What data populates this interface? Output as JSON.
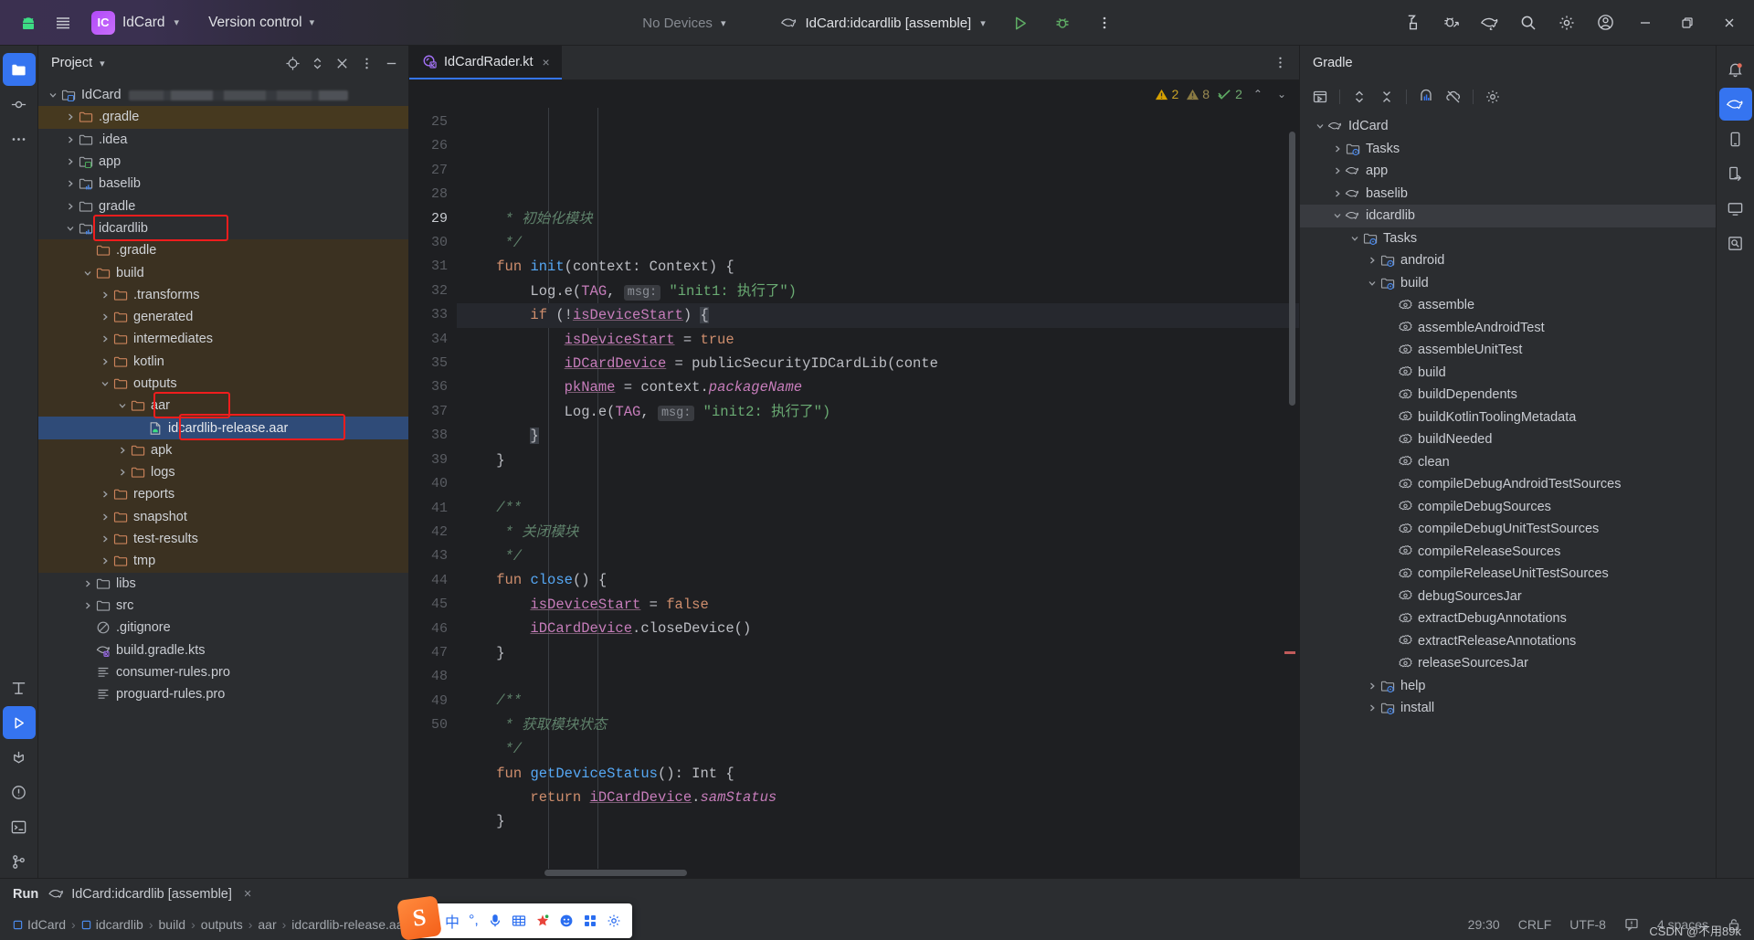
{
  "titlebar": {
    "android_icon": "android-icon",
    "menu_icon": "hamburger-menu-icon",
    "ide_badge": "IC",
    "project_name": "IdCard",
    "version_control": "Version control",
    "devices": "No Devices",
    "run_config": "IdCard:idcardlib [assemble]",
    "run_icon": "run-icon",
    "debug_icon": "debug-icon",
    "more_icon": "more-vertical-icon",
    "right_icons": [
      "build-icon",
      "debug-attach-icon",
      "gradle-elephant-icon",
      "search-icon",
      "settings-gear-icon",
      "account-avatar-icon"
    ],
    "window_min": "minimize-icon",
    "window_max": "restore-icon",
    "window_close": "close-icon"
  },
  "left_rail": {
    "items": [
      {
        "name": "project-tool-icon",
        "active": true
      },
      {
        "name": "commit-tool-icon",
        "active": false
      },
      {
        "name": "more-tools-icon",
        "active": false
      }
    ],
    "bottom_items": [
      {
        "name": "structure-tool-icon"
      },
      {
        "name": "run-tool-icon",
        "active": true
      },
      {
        "name": "build-tool-icon"
      },
      {
        "name": "problems-tool-icon"
      },
      {
        "name": "terminal-tool-icon"
      },
      {
        "name": "git-tool-icon"
      }
    ]
  },
  "project_panel": {
    "title": "Project",
    "actions": [
      "select-opened-file-icon",
      "expand-collapse-icon",
      "hide-icon",
      "options-icon",
      "minimize-icon"
    ],
    "tree": [
      {
        "label": "IdCard",
        "indent": 0,
        "arrow": "down",
        "icon": "module-folder-icon",
        "meta": "blurred-path",
        "state": "normal"
      },
      {
        "label": ".gradle",
        "indent": 1,
        "arrow": "right",
        "icon": "excluded-folder-icon",
        "state": "highlight"
      },
      {
        "label": ".idea",
        "indent": 1,
        "arrow": "right",
        "icon": "folder-icon",
        "state": "normal"
      },
      {
        "label": "app",
        "indent": 1,
        "arrow": "right",
        "icon": "module-folder-green-icon",
        "state": "normal"
      },
      {
        "label": "baselib",
        "indent": 1,
        "arrow": "right",
        "icon": "module-folder-lib-icon",
        "state": "normal"
      },
      {
        "label": "gradle",
        "indent": 1,
        "arrow": "right",
        "icon": "folder-icon",
        "state": "normal"
      },
      {
        "label": "idcardlib",
        "indent": 1,
        "arrow": "down",
        "icon": "module-folder-lib-icon",
        "state": "normal",
        "redbox": true
      },
      {
        "label": ".gradle",
        "indent": 2,
        "arrow": "none",
        "icon": "excluded-folder-icon",
        "state": "excluded"
      },
      {
        "label": "build",
        "indent": 2,
        "arrow": "down",
        "icon": "excluded-folder-icon",
        "state": "excluded"
      },
      {
        "label": ".transforms",
        "indent": 3,
        "arrow": "right",
        "icon": "excluded-folder-icon",
        "state": "excluded"
      },
      {
        "label": "generated",
        "indent": 3,
        "arrow": "right",
        "icon": "excluded-folder-icon",
        "state": "excluded"
      },
      {
        "label": "intermediates",
        "indent": 3,
        "arrow": "right",
        "icon": "excluded-folder-icon",
        "state": "excluded"
      },
      {
        "label": "kotlin",
        "indent": 3,
        "arrow": "right",
        "icon": "excluded-folder-icon",
        "state": "excluded"
      },
      {
        "label": "outputs",
        "indent": 3,
        "arrow": "down",
        "icon": "excluded-folder-icon",
        "state": "excluded"
      },
      {
        "label": "aar",
        "indent": 4,
        "arrow": "down",
        "icon": "excluded-folder-icon",
        "state": "excluded",
        "redbox": true
      },
      {
        "label": "idcardlib-release.aar",
        "indent": 5,
        "arrow": "none",
        "icon": "aar-file-icon",
        "state": "selected",
        "redbox": true
      },
      {
        "label": "apk",
        "indent": 4,
        "arrow": "right",
        "icon": "excluded-folder-icon",
        "state": "excluded"
      },
      {
        "label": "logs",
        "indent": 4,
        "arrow": "right",
        "icon": "excluded-folder-icon",
        "state": "excluded"
      },
      {
        "label": "reports",
        "indent": 3,
        "arrow": "right",
        "icon": "excluded-folder-icon",
        "state": "excluded"
      },
      {
        "label": "snapshot",
        "indent": 3,
        "arrow": "right",
        "icon": "excluded-folder-icon",
        "state": "excluded"
      },
      {
        "label": "test-results",
        "indent": 3,
        "arrow": "right",
        "icon": "excluded-folder-icon",
        "state": "excluded"
      },
      {
        "label": "tmp",
        "indent": 3,
        "arrow": "right",
        "icon": "excluded-folder-icon",
        "state": "excluded"
      },
      {
        "label": "libs",
        "indent": 2,
        "arrow": "right",
        "icon": "folder-icon",
        "state": "normal"
      },
      {
        "label": "src",
        "indent": 2,
        "arrow": "right",
        "icon": "folder-icon",
        "state": "normal"
      },
      {
        "label": ".gitignore",
        "indent": 2,
        "arrow": "none",
        "icon": "gitignore-icon",
        "state": "normal"
      },
      {
        "label": "build.gradle.kts",
        "indent": 2,
        "arrow": "none",
        "icon": "gradle-kts-icon",
        "state": "normal"
      },
      {
        "label": "consumer-rules.pro",
        "indent": 2,
        "arrow": "none",
        "icon": "text-file-icon",
        "state": "normal"
      },
      {
        "label": "proguard-rules.pro",
        "indent": 2,
        "arrow": "none",
        "icon": "text-file-icon",
        "state": "normal"
      }
    ]
  },
  "editor": {
    "tab": {
      "label": "IdCardRader.kt",
      "icon": "kotlin-class-icon",
      "close": "×"
    },
    "tab_options_icon": "more-vertical-icon",
    "inspections": {
      "error_icon": "warning-triangle-icon",
      "error_count": "2",
      "warn_icon": "weak-warning-triangle-icon",
      "warn_count": "8",
      "ok_icon": "checkmark-icon",
      "ok_count": "2",
      "prev": "⌃",
      "next": "⌄"
    },
    "first_line_number": 25,
    "current_line": 29,
    "lines": [
      {
        "n": 25,
        "segments": [
          {
            "t": "     * ",
            "c": "cmt"
          },
          {
            "t": "初始化模块",
            "c": "cmt"
          }
        ]
      },
      {
        "n": 26,
        "segments": [
          {
            "t": "     */",
            "c": "cmt"
          }
        ]
      },
      {
        "n": 27,
        "segments": [
          {
            "t": "    ",
            "c": "plain"
          },
          {
            "t": "fun ",
            "c": "kw"
          },
          {
            "t": "init",
            "c": "fn"
          },
          {
            "t": "(context: Context) {",
            "c": "plain"
          }
        ]
      },
      {
        "n": 28,
        "segments": [
          {
            "t": "        Log.e(",
            "c": "plain"
          },
          {
            "t": "TAG",
            "c": "fld"
          },
          {
            "t": ", ",
            "c": "plain"
          },
          {
            "t": "msg:",
            "c": "hint"
          },
          {
            "t": " \"init1: 执行了\")",
            "c": "str"
          }
        ]
      },
      {
        "n": 29,
        "segments": [
          {
            "t": "        ",
            "c": "plain"
          },
          {
            "t": "if ",
            "c": "kw"
          },
          {
            "t": "(!",
            "c": "plain"
          },
          {
            "t": "isDeviceStart",
            "c": "fldu"
          },
          {
            "t": ") ",
            "c": "plain"
          },
          {
            "t": "{",
            "c": "caret"
          }
        ]
      },
      {
        "n": 30,
        "segments": [
          {
            "t": "            ",
            "c": "plain"
          },
          {
            "t": "isDeviceStart",
            "c": "fldu"
          },
          {
            "t": " = ",
            "c": "plain"
          },
          {
            "t": "true",
            "c": "kw"
          }
        ]
      },
      {
        "n": 31,
        "segments": [
          {
            "t": "            ",
            "c": "plain"
          },
          {
            "t": "iDCardDevice",
            "c": "fldu"
          },
          {
            "t": " = publicSecurityIDCardLib(conte",
            "c": "plain"
          }
        ]
      },
      {
        "n": 32,
        "segments": [
          {
            "t": "            ",
            "c": "plain"
          },
          {
            "t": "pkName",
            "c": "fldu"
          },
          {
            "t": " = context.",
            "c": "plain"
          },
          {
            "t": "packageName",
            "c": "italic"
          }
        ]
      },
      {
        "n": 33,
        "segments": [
          {
            "t": "            Log.e(",
            "c": "plain"
          },
          {
            "t": "TAG",
            "c": "fld"
          },
          {
            "t": ", ",
            "c": "plain"
          },
          {
            "t": "msg:",
            "c": "hint"
          },
          {
            "t": " \"init2: 执行了\")",
            "c": "str"
          }
        ]
      },
      {
        "n": 34,
        "segments": [
          {
            "t": "        ",
            "c": "plain"
          },
          {
            "t": "}",
            "c": "caret"
          }
        ]
      },
      {
        "n": 35,
        "segments": [
          {
            "t": "    }",
            "c": "plain"
          }
        ]
      },
      {
        "n": 36,
        "segments": [
          {
            "t": "",
            "c": "plain"
          }
        ]
      },
      {
        "n": 37,
        "segments": [
          {
            "t": "    /**",
            "c": "cmt"
          }
        ]
      },
      {
        "n": 38,
        "segments": [
          {
            "t": "     * ",
            "c": "cmt"
          },
          {
            "t": "关闭模块",
            "c": "cmt"
          }
        ]
      },
      {
        "n": 39,
        "segments": [
          {
            "t": "     */",
            "c": "cmt"
          }
        ]
      },
      {
        "n": 40,
        "segments": [
          {
            "t": "    ",
            "c": "plain"
          },
          {
            "t": "fun ",
            "c": "kw"
          },
          {
            "t": "close",
            "c": "fn"
          },
          {
            "t": "() {",
            "c": "plain"
          }
        ]
      },
      {
        "n": 41,
        "segments": [
          {
            "t": "        ",
            "c": "plain"
          },
          {
            "t": "isDeviceStart",
            "c": "fldu"
          },
          {
            "t": " = ",
            "c": "plain"
          },
          {
            "t": "false",
            "c": "kw"
          }
        ]
      },
      {
        "n": 42,
        "segments": [
          {
            "t": "        ",
            "c": "plain"
          },
          {
            "t": "iDCardDevice",
            "c": "fldu"
          },
          {
            "t": ".closeDevice()",
            "c": "plain"
          }
        ]
      },
      {
        "n": 43,
        "segments": [
          {
            "t": "    }",
            "c": "plain"
          }
        ]
      },
      {
        "n": 44,
        "segments": [
          {
            "t": "",
            "c": "plain"
          }
        ]
      },
      {
        "n": 45,
        "segments": [
          {
            "t": "    /**",
            "c": "cmt"
          }
        ]
      },
      {
        "n": 46,
        "segments": [
          {
            "t": "     * ",
            "c": "cmt"
          },
          {
            "t": "获取模块状态",
            "c": "cmt"
          }
        ]
      },
      {
        "n": 47,
        "segments": [
          {
            "t": "     */",
            "c": "cmt"
          }
        ]
      },
      {
        "n": 48,
        "segments": [
          {
            "t": "    ",
            "c": "plain"
          },
          {
            "t": "fun ",
            "c": "kw"
          },
          {
            "t": "getDeviceStatus",
            "c": "fn"
          },
          {
            "t": "(): Int {",
            "c": "plain"
          }
        ]
      },
      {
        "n": 49,
        "segments": [
          {
            "t": "        ",
            "c": "plain"
          },
          {
            "t": "return ",
            "c": "kw"
          },
          {
            "t": "iDCardDevice",
            "c": "fldu"
          },
          {
            "t": ".",
            "c": "plain"
          },
          {
            "t": "samStatus",
            "c": "italic"
          }
        ]
      },
      {
        "n": 50,
        "segments": [
          {
            "t": "    }",
            "c": "plain"
          }
        ]
      }
    ]
  },
  "gradle_panel": {
    "title": "Gradle",
    "toolbar_icons": [
      "execute-task-icon",
      "expand-all-icon",
      "collapse-all-icon",
      "toggle-tasks-icon",
      "offline-mode-icon",
      "settings-gear-icon"
    ],
    "tree": [
      {
        "label": "IdCard",
        "indent": 0,
        "arrow": "down",
        "icon": "gradle-elephant-icon",
        "state": "normal"
      },
      {
        "label": "Tasks",
        "indent": 1,
        "arrow": "right",
        "icon": "tasks-folder-icon",
        "state": "normal"
      },
      {
        "label": "app",
        "indent": 1,
        "arrow": "right",
        "icon": "gradle-elephant-icon",
        "state": "normal"
      },
      {
        "label": "baselib",
        "indent": 1,
        "arrow": "right",
        "icon": "gradle-elephant-icon",
        "state": "normal"
      },
      {
        "label": "idcardlib",
        "indent": 1,
        "arrow": "down",
        "icon": "gradle-elephant-icon",
        "state": "selected"
      },
      {
        "label": "Tasks",
        "indent": 2,
        "arrow": "down",
        "icon": "tasks-folder-icon",
        "state": "normal"
      },
      {
        "label": "android",
        "indent": 3,
        "arrow": "right",
        "icon": "tasks-folder-icon",
        "state": "normal"
      },
      {
        "label": "build",
        "indent": 3,
        "arrow": "down",
        "icon": "tasks-folder-icon",
        "state": "normal"
      },
      {
        "label": "assemble",
        "indent": 4,
        "arrow": "none",
        "icon": "gradle-task-icon",
        "state": "normal"
      },
      {
        "label": "assembleAndroidTest",
        "indent": 4,
        "arrow": "none",
        "icon": "gradle-task-icon",
        "state": "normal"
      },
      {
        "label": "assembleUnitTest",
        "indent": 4,
        "arrow": "none",
        "icon": "gradle-task-icon",
        "state": "normal"
      },
      {
        "label": "build",
        "indent": 4,
        "arrow": "none",
        "icon": "gradle-task-icon",
        "state": "normal"
      },
      {
        "label": "buildDependents",
        "indent": 4,
        "arrow": "none",
        "icon": "gradle-task-icon",
        "state": "normal"
      },
      {
        "label": "buildKotlinToolingMetadata",
        "indent": 4,
        "arrow": "none",
        "icon": "gradle-task-icon",
        "state": "normal"
      },
      {
        "label": "buildNeeded",
        "indent": 4,
        "arrow": "none",
        "icon": "gradle-task-icon",
        "state": "normal"
      },
      {
        "label": "clean",
        "indent": 4,
        "arrow": "none",
        "icon": "gradle-task-icon",
        "state": "normal"
      },
      {
        "label": "compileDebugAndroidTestSources",
        "indent": 4,
        "arrow": "none",
        "icon": "gradle-task-icon",
        "state": "normal"
      },
      {
        "label": "compileDebugSources",
        "indent": 4,
        "arrow": "none",
        "icon": "gradle-task-icon",
        "state": "normal"
      },
      {
        "label": "compileDebugUnitTestSources",
        "indent": 4,
        "arrow": "none",
        "icon": "gradle-task-icon",
        "state": "normal"
      },
      {
        "label": "compileReleaseSources",
        "indent": 4,
        "arrow": "none",
        "icon": "gradle-task-icon",
        "state": "normal"
      },
      {
        "label": "compileReleaseUnitTestSources",
        "indent": 4,
        "arrow": "none",
        "icon": "gradle-task-icon",
        "state": "normal"
      },
      {
        "label": "debugSourcesJar",
        "indent": 4,
        "arrow": "none",
        "icon": "gradle-task-icon",
        "state": "normal"
      },
      {
        "label": "extractDebugAnnotations",
        "indent": 4,
        "arrow": "none",
        "icon": "gradle-task-icon",
        "state": "normal"
      },
      {
        "label": "extractReleaseAnnotations",
        "indent": 4,
        "arrow": "none",
        "icon": "gradle-task-icon",
        "state": "normal"
      },
      {
        "label": "releaseSourcesJar",
        "indent": 4,
        "arrow": "none",
        "icon": "gradle-task-icon",
        "state": "normal"
      },
      {
        "label": "help",
        "indent": 3,
        "arrow": "right",
        "icon": "tasks-folder-icon",
        "state": "normal"
      },
      {
        "label": "install",
        "indent": 3,
        "arrow": "right",
        "icon": "tasks-folder-icon",
        "state": "normal"
      }
    ]
  },
  "right_rail": {
    "items": [
      "notifications-bell-icon",
      "gradle-tool-icon",
      "device-manager-icon",
      "device-file-explorer-icon",
      "emulator-icon",
      "app-inspection-icon"
    ]
  },
  "run_bar": {
    "label": "Run",
    "config_icon": "gradle-elephant-icon",
    "config_name": "IdCard:idcardlib [assemble]",
    "close": "×"
  },
  "status_bar": {
    "breadcrumbs": [
      "IdCard",
      "idcardlib",
      "build",
      "outputs",
      "aar",
      "idcardlib-release.aar"
    ],
    "caret": "29:30",
    "line_separator": "CRLF",
    "encoding": "UTF-8",
    "read_only_icon": "notification-icon",
    "indent": "4 spaces",
    "lock_icon": "lock-icon"
  },
  "ime_toolbar": {
    "logo": "S",
    "items": [
      "中",
      "°,",
      "microphone-icon",
      "keyboard-grid-icon",
      "tools-icon",
      "emoji-icon",
      "apps-grid-icon",
      "settings-icon"
    ]
  },
  "watermark": "CSDN @不用89k",
  "colors": {
    "accent": "#3574f0",
    "selection": "#2f4b78",
    "excluded": "#3b3121",
    "redbox": "#f01d1d",
    "panel_bg": "#2b2d30",
    "editor_bg": "#1e1f22"
  }
}
